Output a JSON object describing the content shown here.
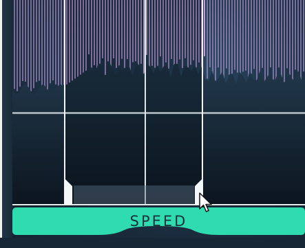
{
  "speed_button": {
    "label": "SPEED"
  },
  "icons": {
    "cursor": "mouse-pointer-icon"
  },
  "colors": {
    "accent": "#2fdcb0",
    "spectrum_bar": "#c9a3e8",
    "spectrum_bar_highlight": "#f0d6ff",
    "background": "#1d3246"
  }
}
